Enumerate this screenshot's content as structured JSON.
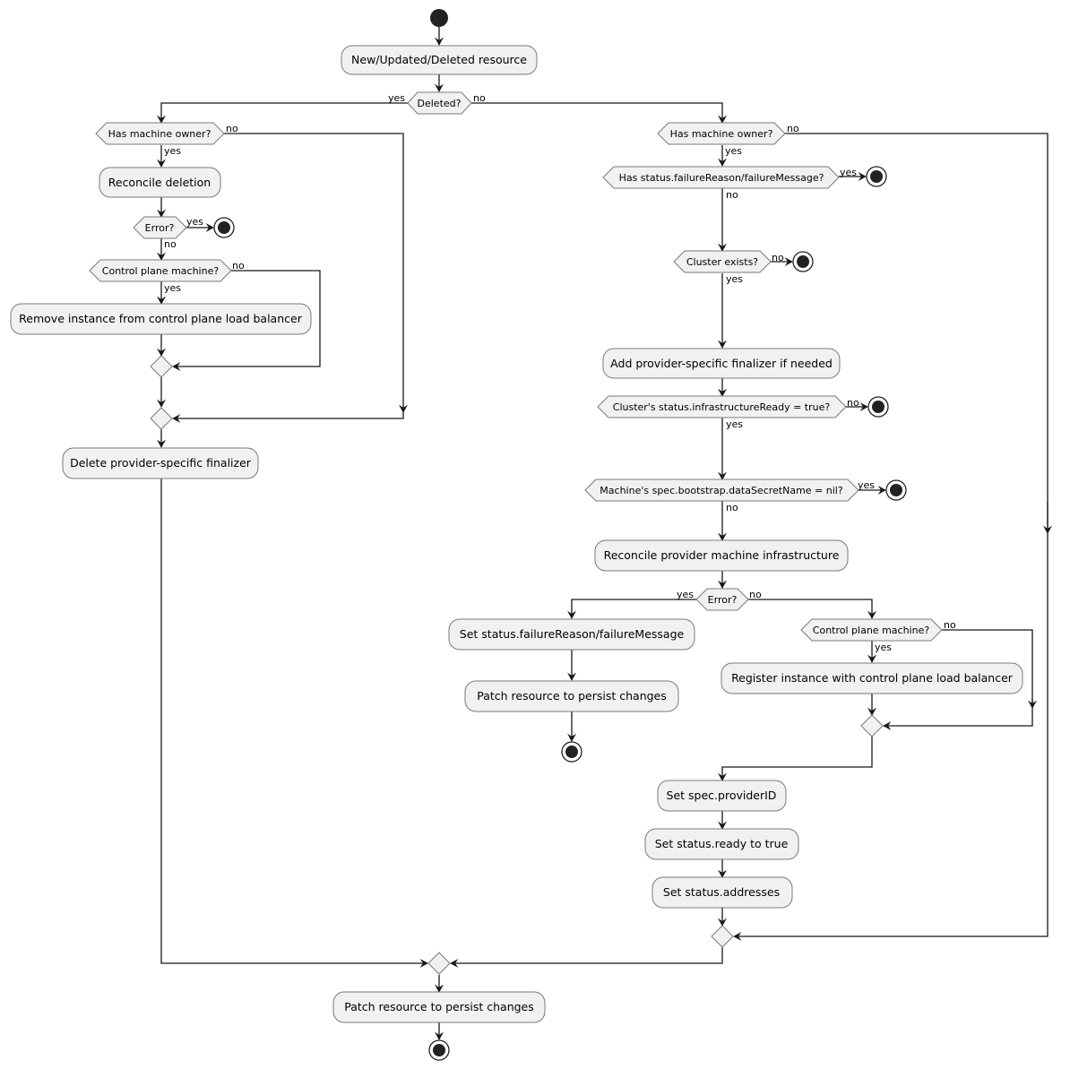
{
  "diagram": {
    "type": "activity",
    "nodes": {
      "start": {
        "kind": "start"
      },
      "new_resource": {
        "kind": "action",
        "label": "New/Updated/Deleted resource"
      },
      "deleted": {
        "kind": "decision",
        "label": "Deleted?"
      },
      "del_has_owner": {
        "kind": "decision",
        "label": "Has machine owner?"
      },
      "reconcile_deletion": {
        "kind": "action",
        "label": "Reconcile deletion"
      },
      "del_error": {
        "kind": "decision",
        "label": "Error?"
      },
      "del_cp_machine": {
        "kind": "decision",
        "label": "Control plane machine?"
      },
      "remove_instance": {
        "kind": "action",
        "label": "Remove instance from control plane load balancer"
      },
      "delete_finalizer": {
        "kind": "action",
        "label": "Delete provider-specific finalizer"
      },
      "has_owner": {
        "kind": "decision",
        "label": "Has machine owner?"
      },
      "has_failure": {
        "kind": "decision",
        "label": "Has status.failureReason/failureMessage?"
      },
      "cluster_exists": {
        "kind": "decision",
        "label": "Cluster exists?"
      },
      "add_finalizer": {
        "kind": "action",
        "label": "Add provider-specific finalizer if needed"
      },
      "infra_ready": {
        "kind": "decision",
        "label": "Cluster's status.infrastructureReady = true?"
      },
      "data_secret": {
        "kind": "decision",
        "label": "Machine's spec.bootstrap.dataSecretName = nil?"
      },
      "reconcile_infra": {
        "kind": "action",
        "label": "Reconcile provider machine infrastructure"
      },
      "rec_error": {
        "kind": "decision",
        "label": "Error?"
      },
      "set_failure": {
        "kind": "action",
        "label": "Set status.failureReason/failureMessage"
      },
      "patch_failure": {
        "kind": "action",
        "label": "Patch resource to persist changes"
      },
      "cp_machine": {
        "kind": "decision",
        "label": "Control plane machine?"
      },
      "register_instance": {
        "kind": "action",
        "label": "Register instance with control plane load balancer"
      },
      "set_provider_id": {
        "kind": "action",
        "label": "Set spec.providerID"
      },
      "set_ready": {
        "kind": "action",
        "label": "Set status.ready to true"
      },
      "set_addresses": {
        "kind": "action",
        "label": "Set status.addresses"
      },
      "patch_final": {
        "kind": "action",
        "label": "Patch resource to persist changes"
      }
    },
    "edge_labels": {
      "yes": "yes",
      "no": "no"
    }
  }
}
